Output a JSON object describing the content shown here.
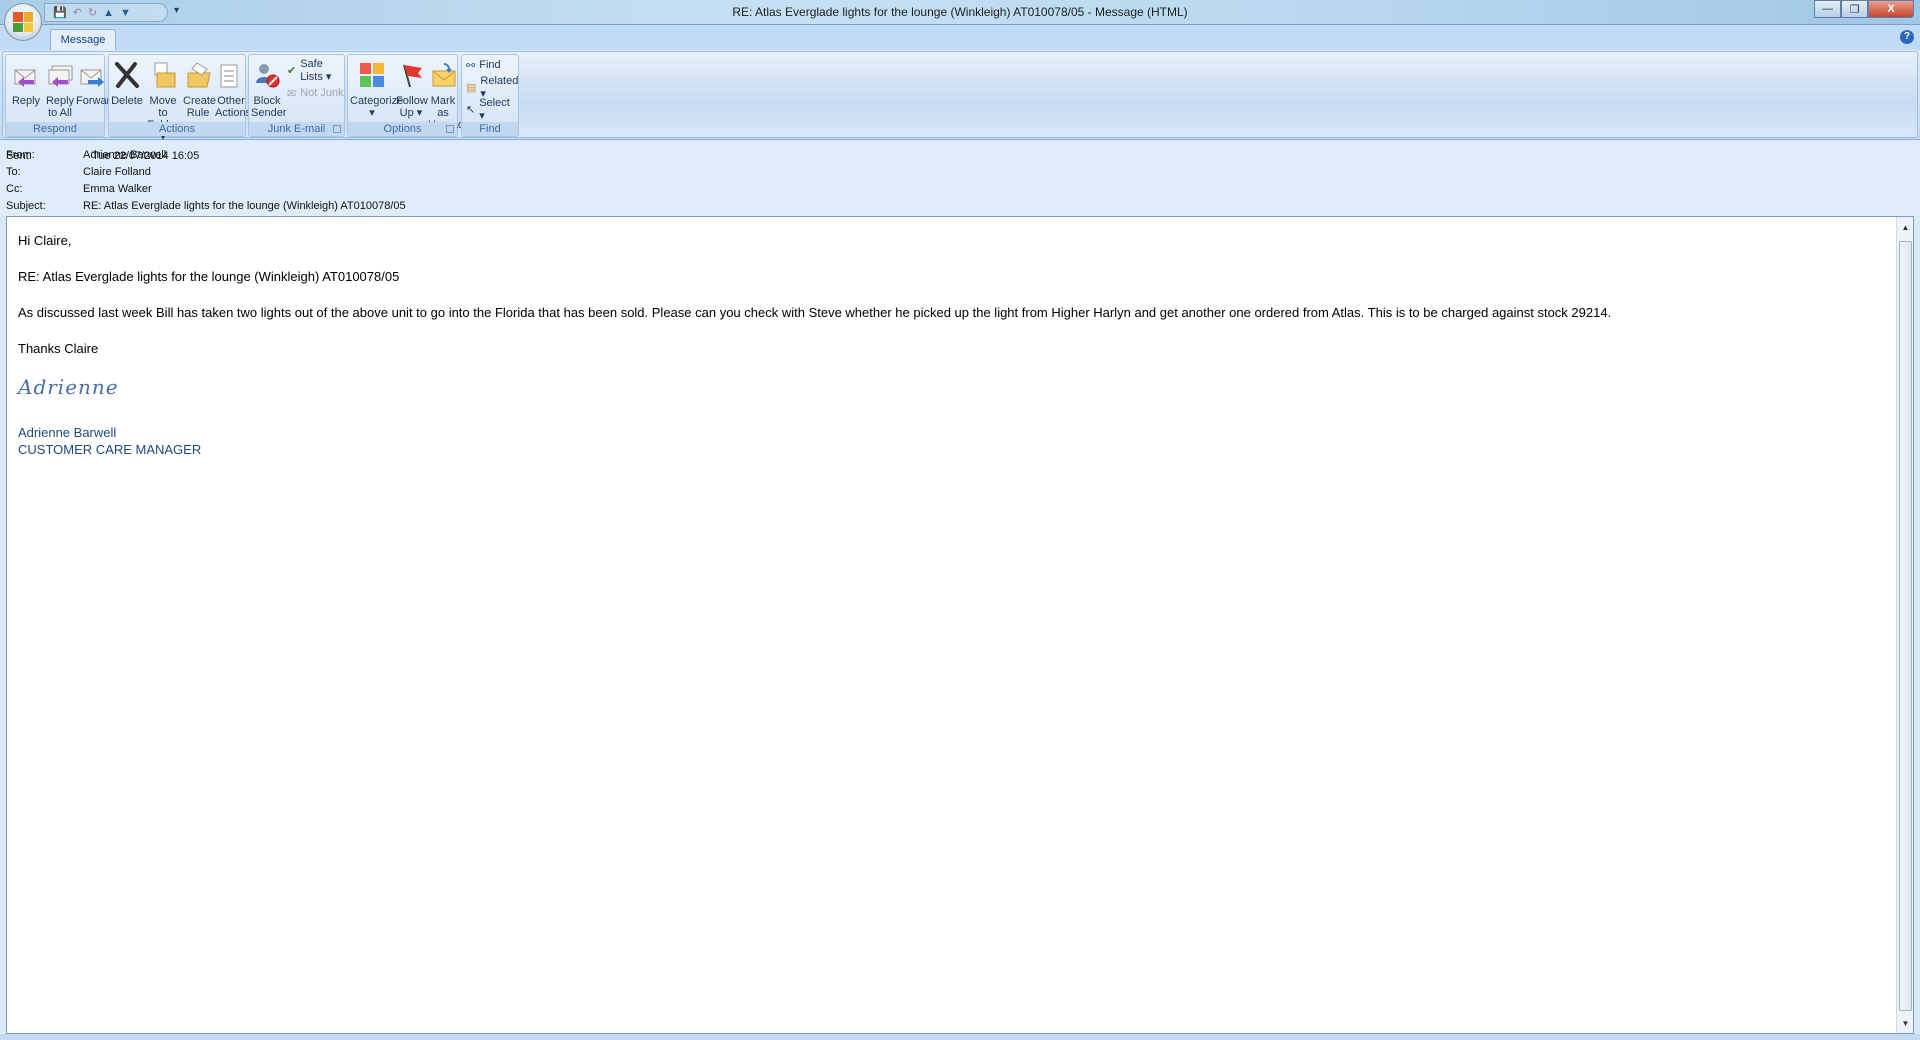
{
  "window": {
    "title": "RE: Atlas Everglade lights for the lounge (Winkleigh) AT010078/05  -  Message (HTML)",
    "minimize": "—",
    "restore": "❐",
    "close": "X"
  },
  "tabs": [
    {
      "label": "Message"
    }
  ],
  "ribbon": {
    "respond": {
      "label": "Respond",
      "reply": "Reply",
      "reply_all_1": "Reply",
      "reply_all_2": "to All",
      "forward": "Forward"
    },
    "actions": {
      "label": "Actions",
      "delete": "Delete",
      "move_1": "Move to",
      "move_2": "Folder ▾",
      "rule_1": "Create",
      "rule_2": "Rule",
      "other_1": "Other",
      "other_2": "Actions ▾"
    },
    "junk": {
      "label": "Junk E-mail",
      "block_1": "Block",
      "block_2": "Sender",
      "safe_lists": "Safe Lists ▾",
      "not_junk": "Not Junk"
    },
    "options": {
      "label": "Options",
      "categorize": "Categorize",
      "categorize_arrow": "▾",
      "follow_1": "Follow",
      "follow_2": "Up ▾",
      "mark_1": "Mark as",
      "mark_2": "Unread"
    },
    "find": {
      "label": "Find",
      "find": "Find",
      "related": "Related ▾",
      "select": "Select ▾"
    }
  },
  "header": {
    "from_label": "From:",
    "from": "Adrienne Barwell",
    "to_label": "To:",
    "to": "Claire Folland",
    "cc_label": "Cc:",
    "cc": "Emma Walker",
    "subject_label": "Subject:",
    "subject": "RE: Atlas Everglade lights for the lounge (Winkleigh) AT010078/05",
    "sent_label": "Sent:",
    "sent": "Tue 22/07/2014 16:05"
  },
  "body": {
    "greeting": "Hi Claire,",
    "ref": "RE: Atlas Everglade lights for the lounge (Winkleigh) AT010078/05",
    "paragraph": "As discussed last week Bill has taken two lights out of the above unit to go into the Florida that has been sold.  Please can you check with Steve whether he picked up the light from Higher Harlyn and get another one ordered from Atlas.  This is to be charged against stock 29214.",
    "thanks": "Thanks Claire",
    "signature_script": "Adrienne",
    "sig_name": "Adrienne Barwell",
    "sig_title": "CUSTOMER CARE MANAGER"
  }
}
